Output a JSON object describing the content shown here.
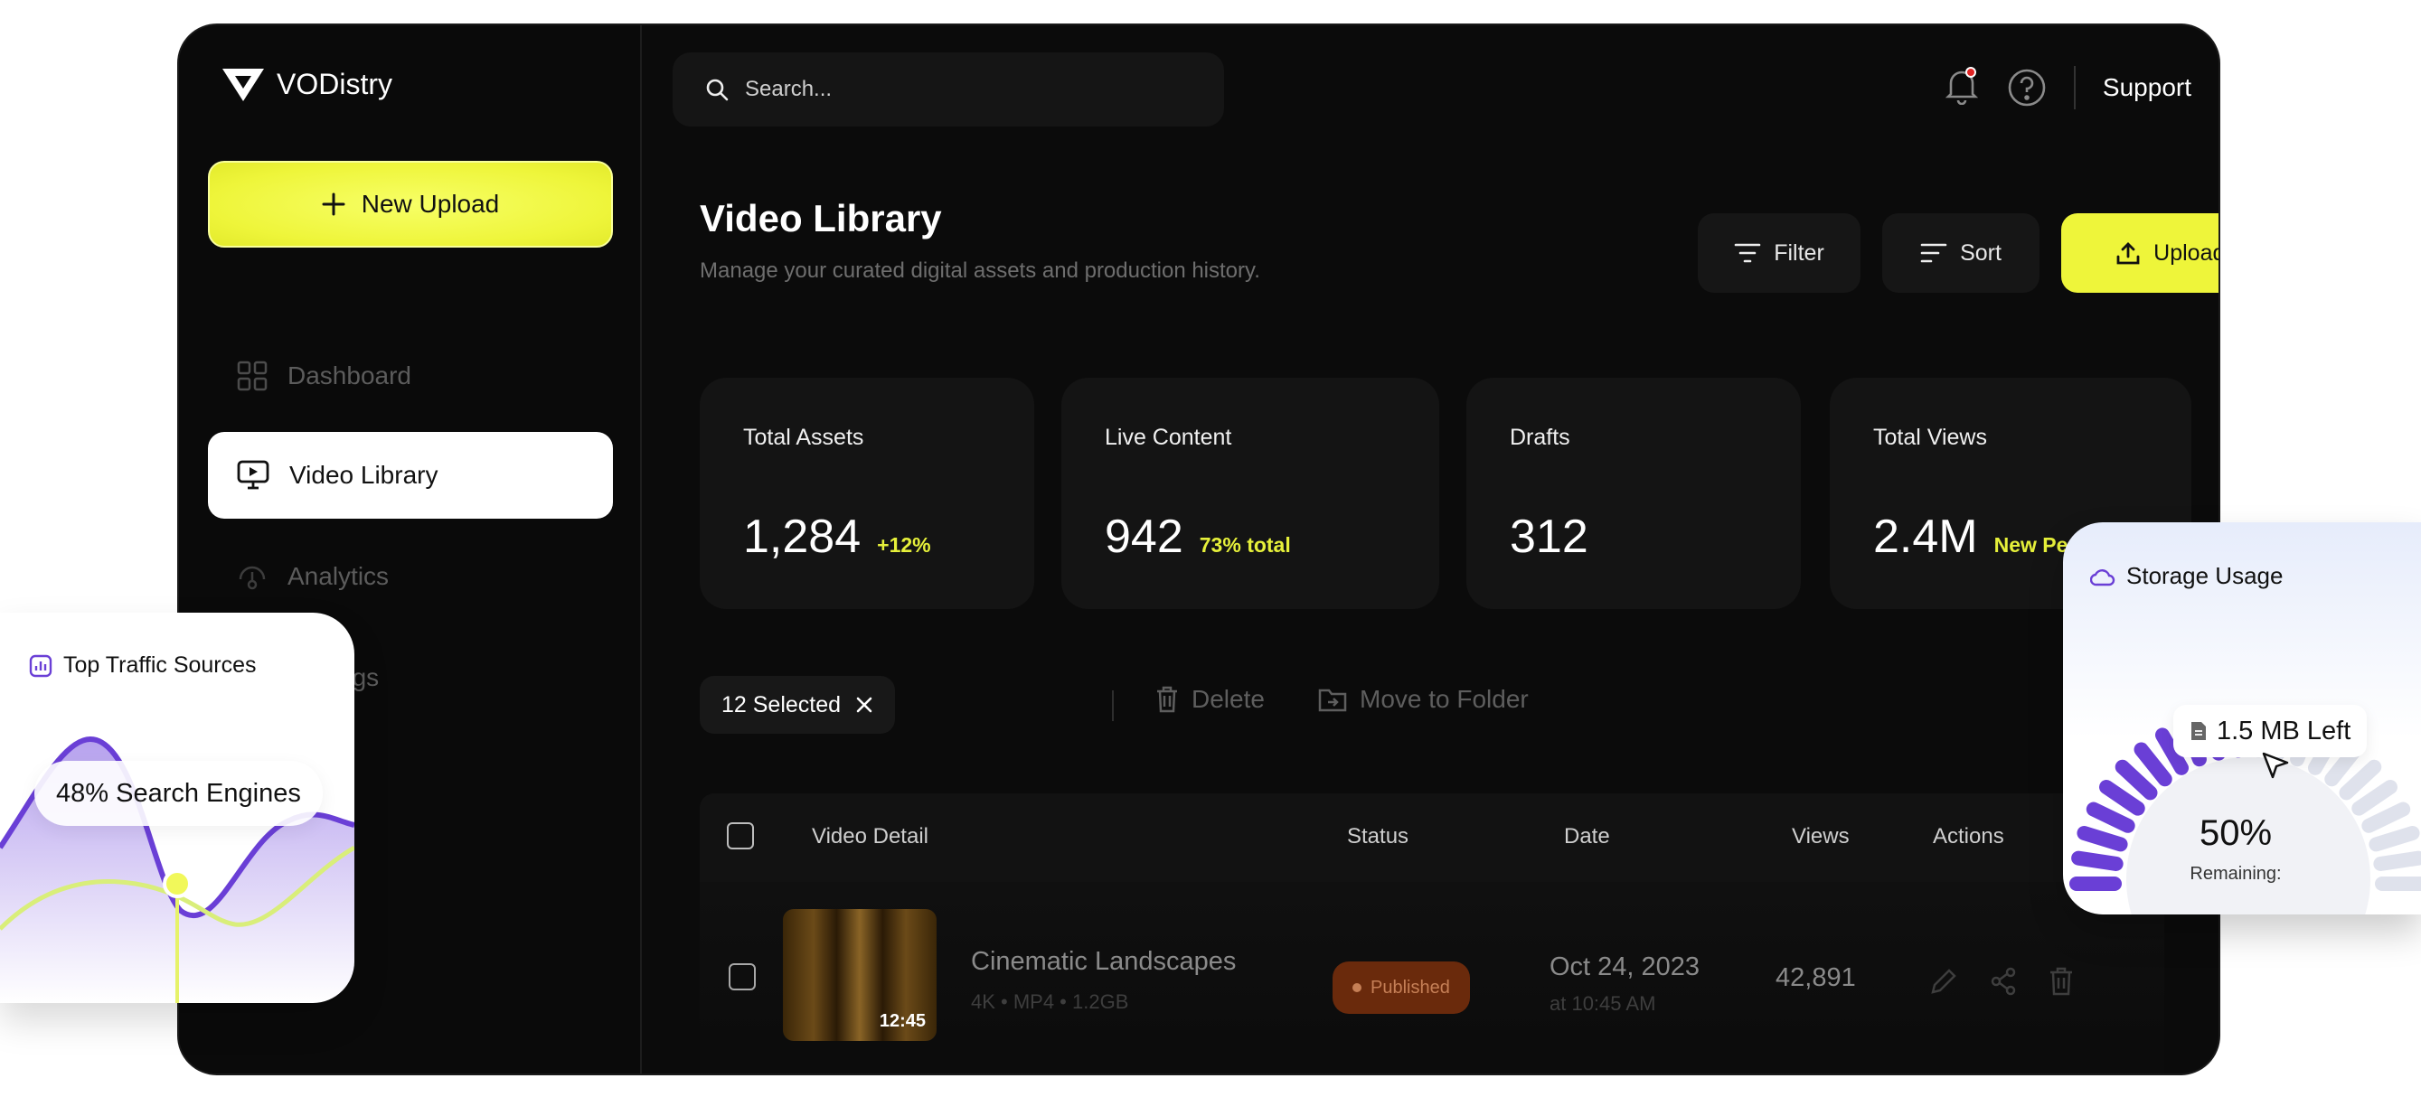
{
  "brand": {
    "name": "VODistry"
  },
  "sidebar": {
    "new_upload": "New Upload",
    "items": [
      {
        "label": "Dashboard",
        "icon": "grid-icon",
        "active": false
      },
      {
        "label": "Video Library",
        "icon": "monitor-play-icon",
        "active": true
      },
      {
        "label": "Analytics",
        "icon": "analytics-icon",
        "active": false
      },
      {
        "label": "Settings",
        "icon": "gear-icon",
        "active": false
      }
    ]
  },
  "header": {
    "search_placeholder": "Search...",
    "support": "Support"
  },
  "page": {
    "title": "Video Library",
    "subtitle": "Manage your curated digital assets and production history.",
    "filter": "Filter",
    "sort": "Sort",
    "upload": "Upload Video"
  },
  "stats": [
    {
      "label": "Total Assets",
      "value": "1,284",
      "delta": "+12%"
    },
    {
      "label": "Live Content",
      "value": "942",
      "delta": "73% total"
    },
    {
      "label": "Drafts",
      "value": "312",
      "delta": ""
    },
    {
      "label": "Total Views",
      "value": "2.4M",
      "delta": "New Pe"
    }
  ],
  "bulk": {
    "selected": "12 Selected",
    "delete": "Delete",
    "move": "Move to Folder"
  },
  "table": {
    "headers": [
      "Video Detail",
      "Status",
      "Date",
      "Views",
      "Actions"
    ],
    "rows": [
      {
        "name": "Cinematic Landscapes",
        "meta": "4K • MP4 • 1.2GB",
        "duration": "12:45",
        "status": "Published",
        "date": "Oct 24, 2023",
        "time": "at 10:45 AM",
        "views": "42,891"
      }
    ]
  },
  "traffic_card": {
    "title": "Top Traffic Sources",
    "highlight": "48% Search Engines"
  },
  "storage_card": {
    "title": "Storage Usage",
    "left": "1.5 MB Left",
    "percent": "50%",
    "remaining_label": "Remaining:",
    "used_fraction": 0.5
  },
  "colors": {
    "accent": "#EEF53A",
    "background": "#0B0B0B",
    "purple": "#6A3FD6",
    "status_published": "#6A2A0C"
  }
}
